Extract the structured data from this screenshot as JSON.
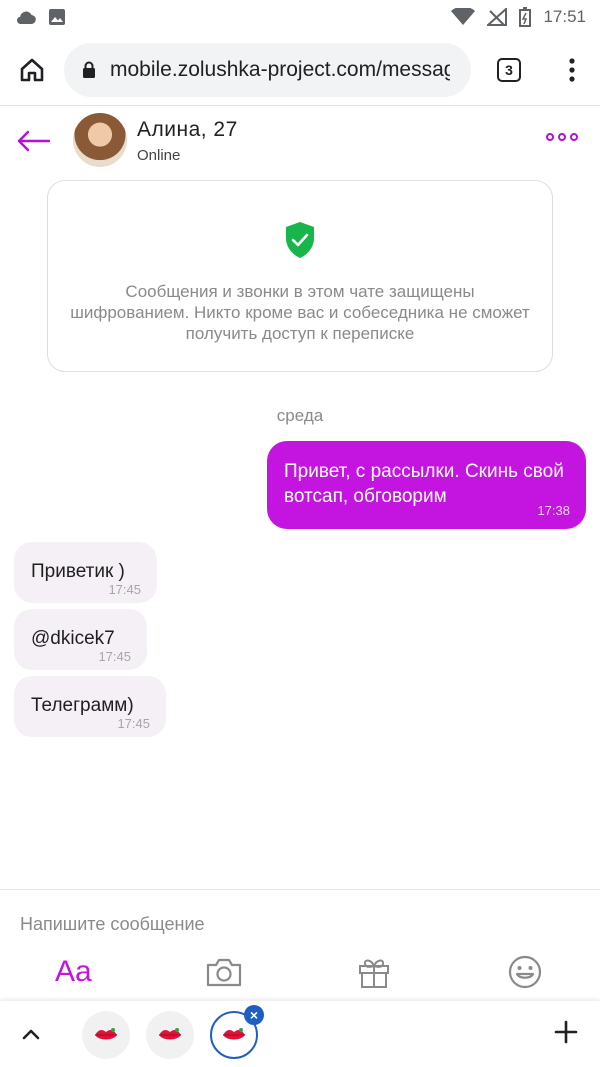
{
  "status_bar": {
    "time": "17:51"
  },
  "browser": {
    "url": "mobile.zolushka-project.com/messag",
    "tab_count": "3"
  },
  "chat": {
    "contact_name": "Алина, 27",
    "contact_status": "Online"
  },
  "encryption_notice": {
    "text": "Сообщения и звонки в этом чате защищены шифрованием. Никто кроме вас и собеседника не сможет получить доступ к переписке"
  },
  "day_label": "среда",
  "messages": [
    {
      "direction": "out",
      "text": "Привет, с рассылки. Скинь свой вотсап, обговорим",
      "time": "17:38"
    },
    {
      "direction": "in",
      "text": "Приветик )",
      "time": "17:45"
    },
    {
      "direction": "in",
      "text": "@dkicek7",
      "time": "17:45"
    },
    {
      "direction": "in",
      "text": "Телеграмм)",
      "time": "17:45"
    }
  ],
  "composer": {
    "placeholder": "Напишите сообщение",
    "tools": [
      "text-format-icon",
      "camera-icon",
      "gift-icon",
      "emoji-icon"
    ],
    "text_format_label": "Aa"
  },
  "colors": {
    "accent": "#c314e0",
    "incoming_bubble": "#f4f0f6",
    "shield": "#17b54a",
    "active_ring": "#1f5fbf"
  }
}
